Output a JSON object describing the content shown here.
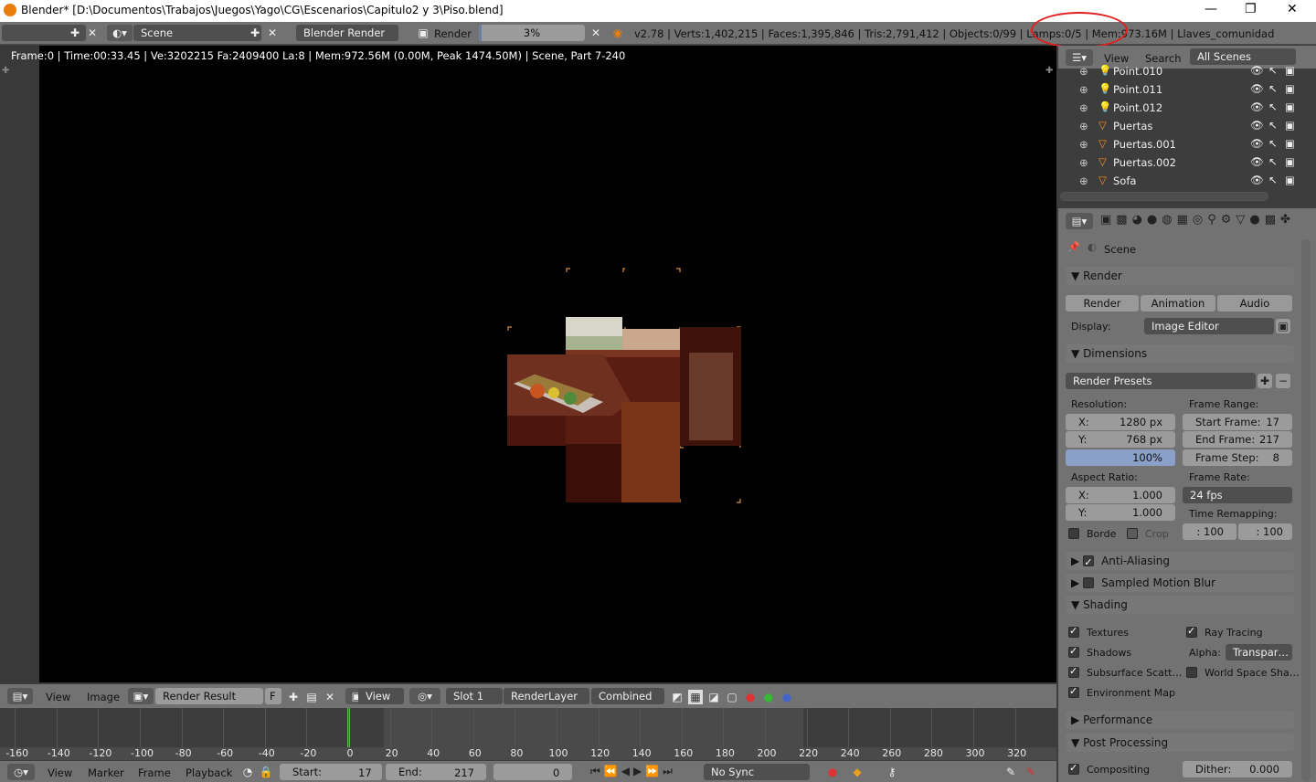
{
  "window": {
    "title": "Blender* [D:\\Documentos\\Trabajos\\Juegos\\Yago\\CG\\Escenarios\\Capitulo2 y 3\\Piso.blend]",
    "minimize": "—",
    "maximize": "❐",
    "close": "✕"
  },
  "info_bar": {
    "scene_name": "Scene",
    "render_engine": "Blender Render",
    "render_button": "Render",
    "progress": "3%",
    "progress_value": 0.03,
    "stats": "v2.78 | Verts:1,402,215 | Faces:1,395,846 | Tris:2,791,412 | Objects:0/99 | Lamps:0/5 | Mem:973.16M | Llaves_comunidad"
  },
  "viewport": {
    "render_stats": "Frame:0 | Time:00:33.45 | Ve:3202215 Fa:2409400 La:8 | Mem:972.56M (0.00M, Peak 1474.50M) | Scene, Part 7-240"
  },
  "image_editor_header": {
    "menu_view": "View",
    "menu_image": "Image",
    "image_name": "Render Result",
    "fake_user": "F",
    "view_mode": "View",
    "slot": "Slot 1",
    "layer": "RenderLayer",
    "pass": "Combined"
  },
  "timeline": {
    "ticks": [
      "-160",
      "-140",
      "-120",
      "-100",
      "-80",
      "-60",
      "-40",
      "-20",
      "0",
      "20",
      "40",
      "60",
      "80",
      "100",
      "120",
      "140",
      "160",
      "180",
      "200",
      "220",
      "240",
      "260",
      "280",
      "300",
      "320"
    ],
    "current_frame_marker": 0,
    "menu_view": "View",
    "menu_marker": "Marker",
    "menu_frame": "Frame",
    "menu_playback": "Playback",
    "start_label": "Start:",
    "start_value": "17",
    "end_label": "End:",
    "end_value": "217",
    "current_frame": "0",
    "sync": "No Sync"
  },
  "outliner": {
    "menu_view": "View",
    "menu_search": "Search",
    "scope": "All Scenes",
    "items": [
      {
        "name": "Point.010",
        "type": "lamp"
      },
      {
        "name": "Point.011",
        "type": "lamp"
      },
      {
        "name": "Point.012",
        "type": "lamp"
      },
      {
        "name": "Puertas",
        "type": "mesh"
      },
      {
        "name": "Puertas.001",
        "type": "mesh"
      },
      {
        "name": "Puertas.002",
        "type": "mesh"
      },
      {
        "name": "Sofa",
        "type": "mesh"
      }
    ]
  },
  "properties": {
    "context": "Scene",
    "render_panel": {
      "title": "Render",
      "render_btn": "Render",
      "animation_btn": "Animation",
      "audio_btn": "Audio",
      "display_label": "Display:",
      "display_value": "Image Editor"
    },
    "dimensions_panel": {
      "title": "Dimensions",
      "presets": "Render Presets",
      "resolution_label": "Resolution:",
      "res_x_label": "X:",
      "res_x": "1280 px",
      "res_y_label": "Y:",
      "res_y": "768 px",
      "res_pct": "100%",
      "frame_range_label": "Frame Range:",
      "start_frame_label": "Start Frame:",
      "start_frame": "17",
      "end_frame_label": "End Frame:",
      "end_frame": "217",
      "frame_step_label": "Frame Step:",
      "frame_step": "8",
      "aspect_label": "Aspect Ratio:",
      "aspect_x_label": "X:",
      "aspect_x": "1.000",
      "aspect_y_label": "Y:",
      "aspect_y": "1.000",
      "frame_rate_label": "Frame Rate:",
      "frame_rate": "24 fps",
      "time_remap_label": "Time Remapping:",
      "remap_old": ": 100",
      "remap_new": ": 100",
      "border_label": "Borde",
      "crop_label": "Crop"
    },
    "anti_aliasing": "Anti-Aliasing",
    "motion_blur": "Sampled Motion Blur",
    "shading_panel": {
      "title": "Shading",
      "textures": "Textures",
      "ray_tracing": "Ray Tracing",
      "shadows": "Shadows",
      "alpha_label": "Alpha:",
      "alpha_value": "Transpar…",
      "sss": "Subsurface Scatt…",
      "world_space": "World Space Sha…",
      "env_map": "Environment Map"
    },
    "performance": "Performance",
    "post_processing": {
      "title": "Post Processing",
      "compositing": "Compositing",
      "dither_label": "Dither:",
      "dither_value": "0.000"
    }
  }
}
